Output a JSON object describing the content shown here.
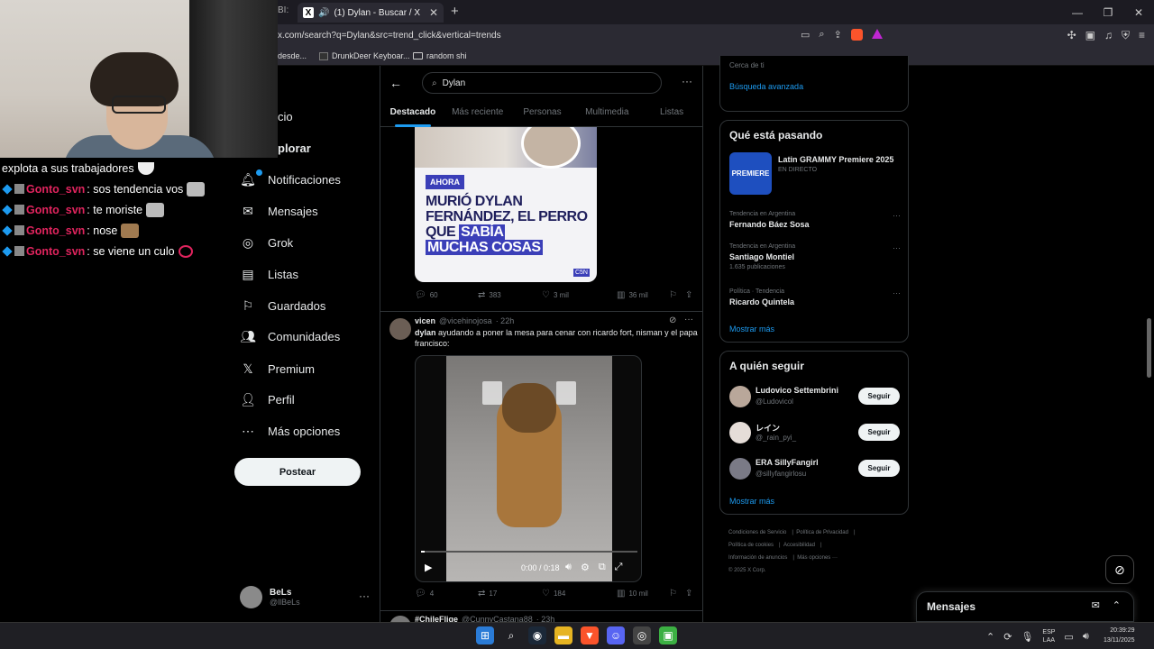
{
  "browser": {
    "tab_partial": "BI:",
    "tab_title": "(1) Dylan - Buscar / X",
    "url": "x.com/search?q=Dylan&src=trend_click&vertical=trends",
    "bookmarks": [
      {
        "label": "desde..."
      },
      {
        "label": "DrunkDeer Keyboar..."
      },
      {
        "label": "random shi"
      }
    ]
  },
  "chat": {
    "first_line": "explota a sus trabajadores",
    "messages": [
      {
        "user": "Gonto_svn",
        "text": ": sos tendencia vos"
      },
      {
        "user": "Gonto_svn",
        "text": ": te moriste"
      },
      {
        "user": "Gonto_svn",
        "text": ": nose"
      },
      {
        "user": "Gonto_svn",
        "text": ": se viene un culo"
      }
    ]
  },
  "nav": {
    "items": [
      {
        "label": "cio",
        "icon": "home-icon"
      },
      {
        "label": "plorar",
        "icon": "explore-icon"
      },
      {
        "label": "Notificaciones",
        "icon": "bell-icon"
      },
      {
        "label": "Mensajes",
        "icon": "mail-icon"
      },
      {
        "label": "Grok",
        "icon": "grok-icon"
      },
      {
        "label": "Listas",
        "icon": "list-icon"
      },
      {
        "label": "Guardados",
        "icon": "bookmark-icon"
      },
      {
        "label": "Comunidades",
        "icon": "people-icon"
      },
      {
        "label": "Premium",
        "icon": "x-icon"
      },
      {
        "label": "Perfil",
        "icon": "person-icon"
      },
      {
        "label": "Más opciones",
        "icon": "more-circle-icon"
      }
    ],
    "post_button": "Postear",
    "account": {
      "name": "BeLs",
      "handle": "@llBeLs"
    }
  },
  "search": {
    "query": "Dylan",
    "tabs": [
      "Destacado",
      "Más reciente",
      "Personas",
      "Multimedia",
      "Listas"
    ],
    "active_tab": "Destacado"
  },
  "post1": {
    "badge": "AHORA",
    "headline_part1": "MURIÓ DYLAN FERNÁNDEZ, EL PERRO QUE ",
    "headline_hl1": "SABÍA",
    "headline_hl2": "MUCHAS COSAS",
    "replies": "60",
    "reposts": "383",
    "likes": "3 mil",
    "views": "36 mil"
  },
  "post2": {
    "name": "vicen",
    "handle": "@vicehinojosa",
    "time": "· 22h",
    "text_bold": "dylan",
    "text": " ayudando a poner la mesa para cenar con ricardo fort, nisman y el papa francisco:",
    "video_time": "0:00 / 0:18",
    "replies": "4",
    "reposts": "17",
    "likes": "184",
    "views": "10 mil"
  },
  "post3": {
    "name": "#ChileFlige",
    "handle": "@CunnyCastana88",
    "time": "· 23h"
  },
  "right": {
    "top_partial": "Cerca de ti",
    "advanced_search": "Búsqueda avanzada",
    "whats_happening": {
      "title": "Qué está pasando",
      "event": {
        "title": "Latin GRAMMY Premiere 2025",
        "subtitle": "EN DIRECTO",
        "image_text": "PREMIERE"
      },
      "trends": [
        {
          "context": "Tendencia en Argentina",
          "name": "Fernando Báez Sosa",
          "count": ""
        },
        {
          "context": "Tendencia en Argentina",
          "name": "Santiago Montiel",
          "count": "1.635 publicaciones"
        },
        {
          "context": "Política · Tendencia",
          "name": "Ricardo Quintela",
          "count": ""
        }
      ],
      "show_more": "Mostrar más"
    },
    "who_to_follow": {
      "title": "A quién seguir",
      "users": [
        {
          "name": "Ludovico Settembrini",
          "handle": "@Ludovicol",
          "button": "Seguir"
        },
        {
          "name": "レイン",
          "handle": "@_rain_pyi_",
          "button": "Seguir"
        },
        {
          "name": "ERA SillyFangirl",
          "handle": "@sillyfangirlosu",
          "button": "Seguir"
        }
      ],
      "show_more": "Mostrar más"
    },
    "footer": {
      "l1": "Condiciones de Servicio",
      "l2": "Política de Privacidad",
      "l3": "Política de cookies",
      "l4": "Accesibilidad",
      "l5": "Información de anuncios",
      "l6": "Más opciones ···",
      "copyright": "© 2025 X Corp."
    }
  },
  "messages_drawer": {
    "title": "Mensajes"
  },
  "taskbar": {
    "lang_top": "ESP",
    "lang_bottom": "LAA",
    "time": "20:39:29",
    "date": "13/11/2025"
  }
}
